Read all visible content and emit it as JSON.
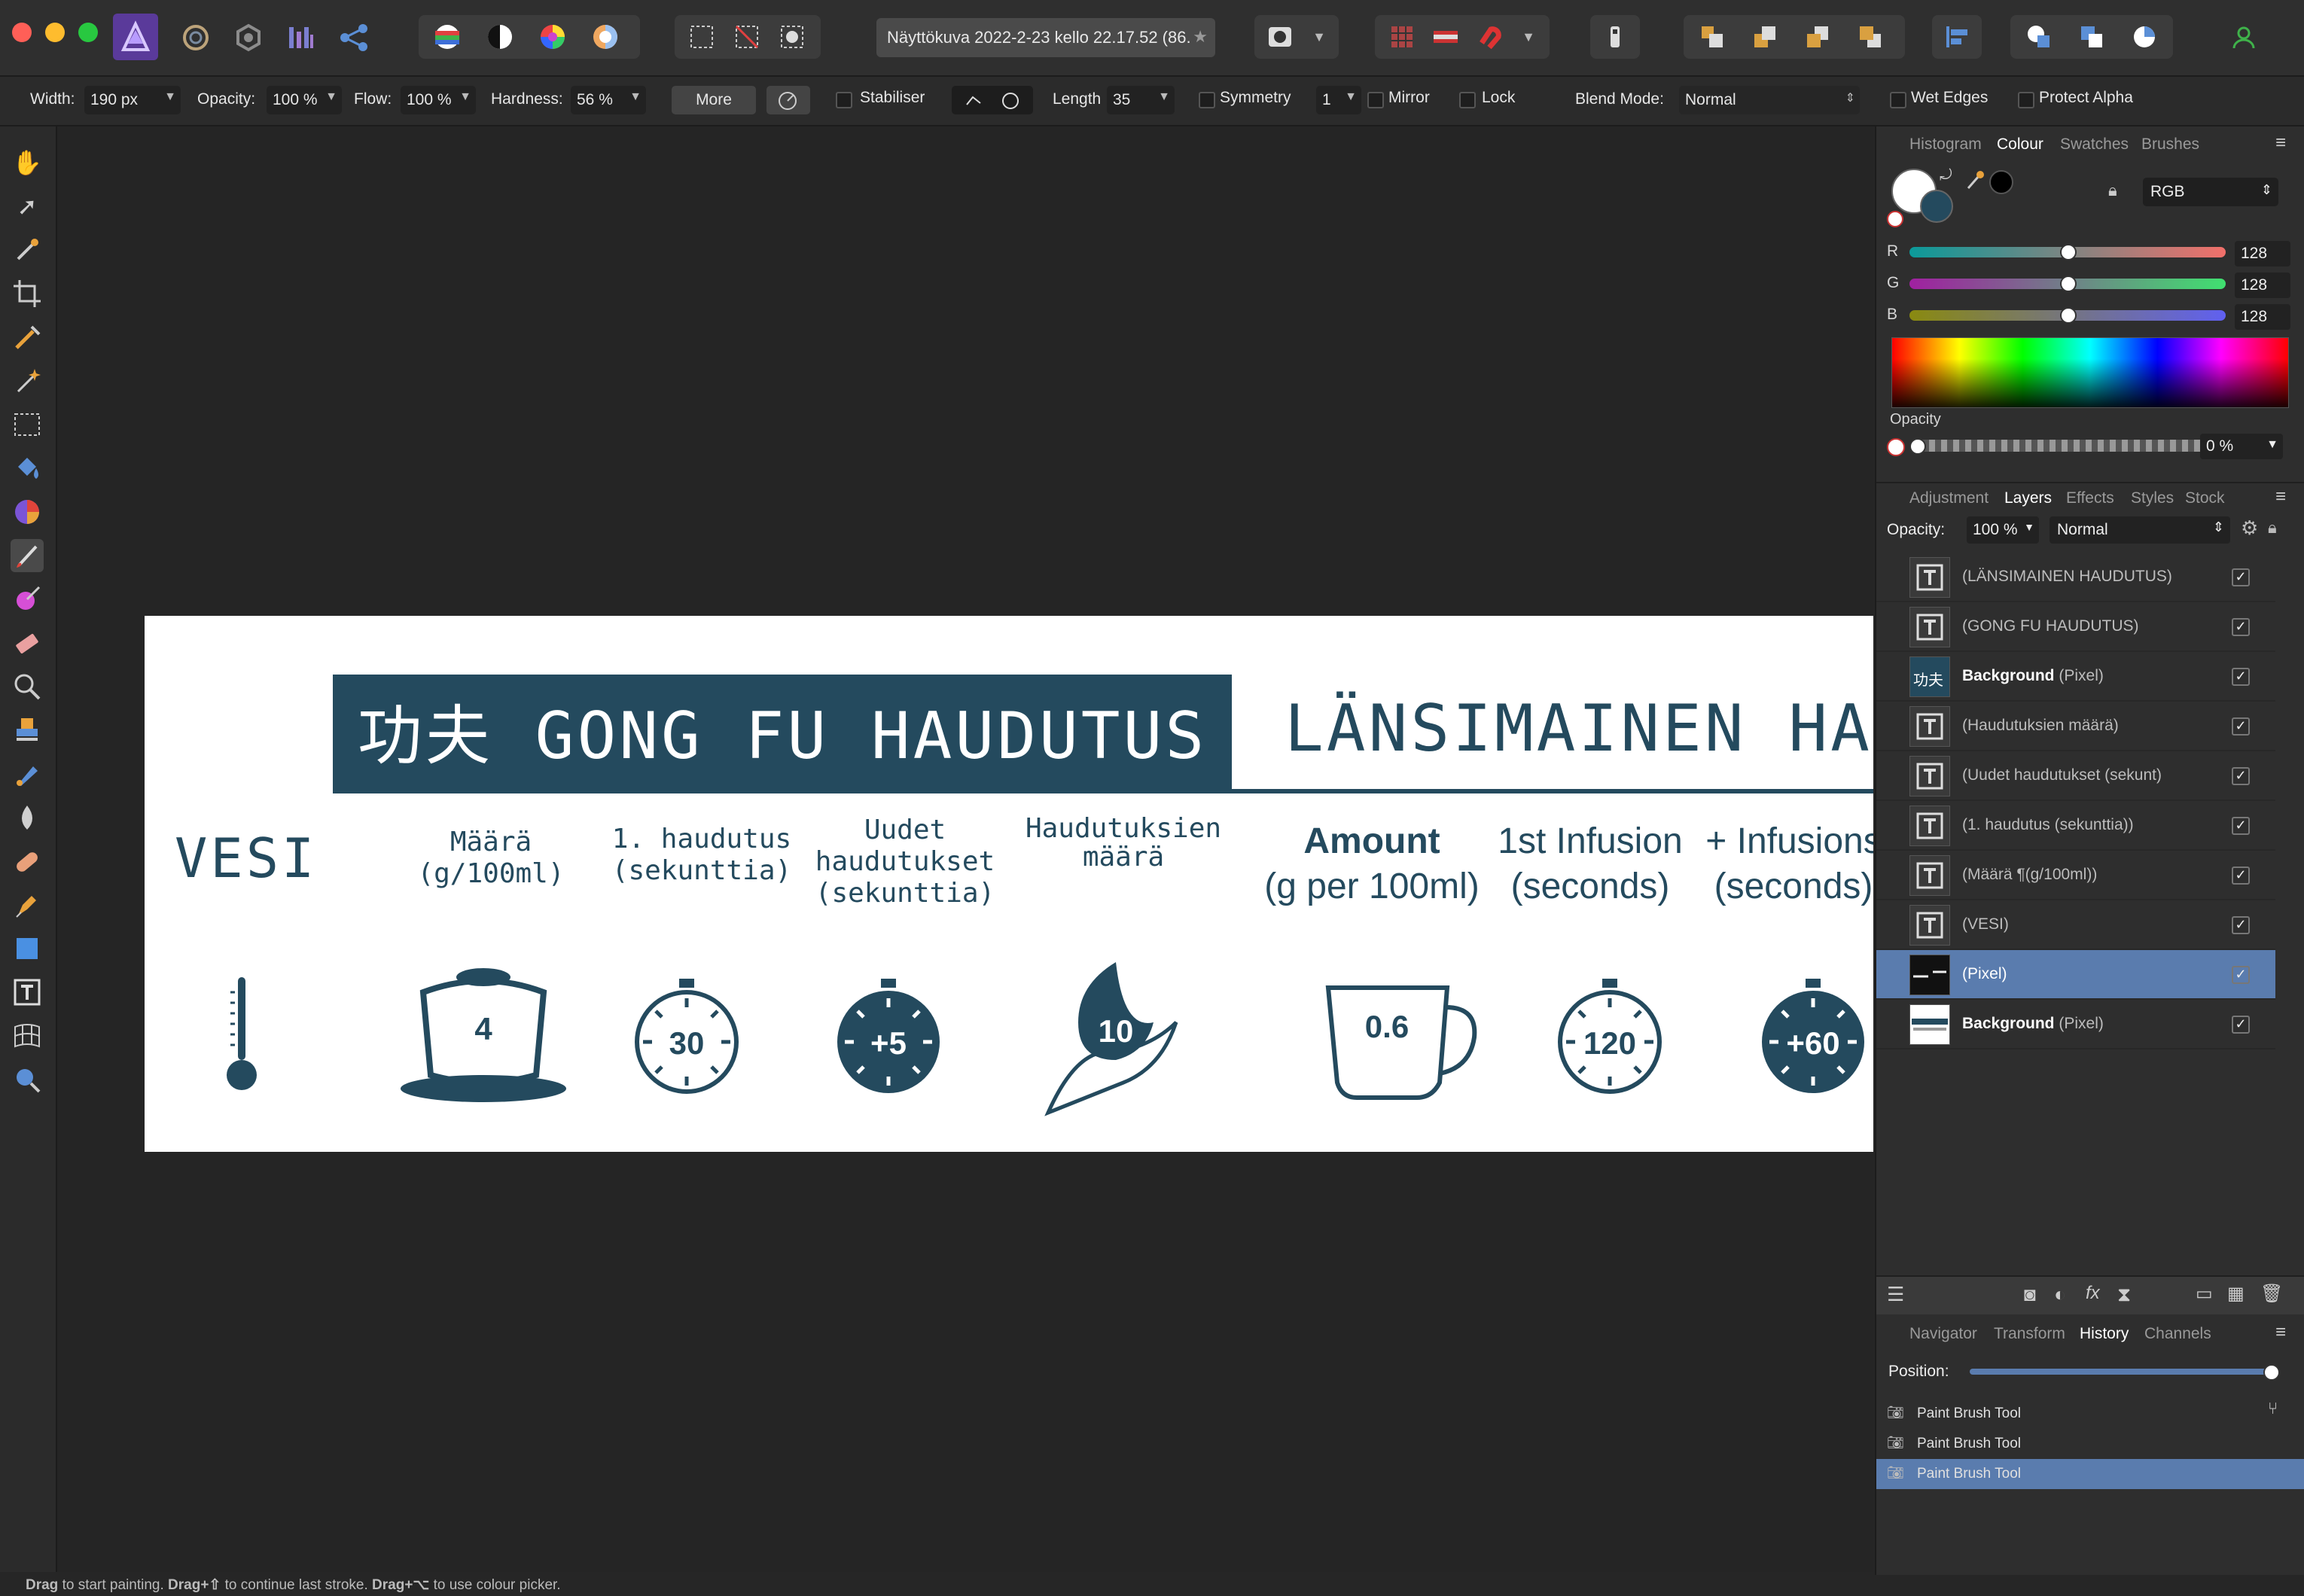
{
  "window": {
    "document_tab": "Näyttökuva 2022-2-23 kello 22.17.52 (86."
  },
  "context_toolbar": {
    "width_label": "Width:",
    "width_value": "190 px",
    "opacity_label": "Opacity:",
    "opacity_value": "100 %",
    "flow_label": "Flow:",
    "flow_value": "100 %",
    "hardness_label": "Hardness:",
    "hardness_value": "56 %",
    "more_label": "More",
    "stabiliser_label": "Stabiliser",
    "length_label": "Length",
    "length_value": "35",
    "symmetry_label": "Symmetry",
    "symmetry_value": "1",
    "mirror_label": "Mirror",
    "lock_label": "Lock",
    "blend_mode_label": "Blend Mode:",
    "blend_mode_value": "Normal",
    "wet_edges_label": "Wet Edges",
    "protect_alpha_label": "Protect Alpha"
  },
  "artwork": {
    "gongfu_title": "功夫 GONG FU HAUDUTUS",
    "western_title": "LÄNSIMAINEN HAUDU",
    "vesi": "VESI",
    "fi_amount_1": "Määrä",
    "fi_amount_2": "(g/100ml)",
    "fi_first_1": "1. haudutus",
    "fi_first_2": "(sekunttia)",
    "fi_new_1": "Uudet",
    "fi_new_2": "haudutukset",
    "fi_new_3": "(sekunttia)",
    "fi_count_1": "Haudutuksien",
    "fi_count_2": "määrä",
    "en_amount_1": "Amount",
    "en_amount_2": "(g per 100ml)",
    "en_first_1": "1st Infusion",
    "en_first_2": "(seconds)",
    "en_plus_1": "+ Infusions",
    "en_plus_2": "(seconds)",
    "en_cut": "A",
    "gaiwan_value": "4",
    "timer_first_value": "30",
    "timer_plus_value": "+5",
    "leaf_value": "10",
    "cup_value": "0.6",
    "timer_western_value": "120",
    "timer_western_plus_value": "+60"
  },
  "colour_panel": {
    "tabs": [
      "Histogram",
      "Colour",
      "Swatches",
      "Brushes"
    ],
    "active_tab": "Colour",
    "model": "RGB",
    "r_label": "R",
    "r_value": "128",
    "g_label": "G",
    "g_value": "128",
    "b_label": "B",
    "b_value": "128",
    "opacity_label": "Opacity",
    "opacity_value": "0 %"
  },
  "layers_panel": {
    "tabs": [
      "Adjustment",
      "Layers",
      "Effects",
      "Styles",
      "Stock"
    ],
    "active_tab": "Layers",
    "opacity_label": "Opacity:",
    "opacity_value": "100 %",
    "blend_value": "Normal",
    "layers": [
      {
        "name": "(LÄNSIMAINEN HAUDUTUS)",
        "bold": "",
        "type": "text"
      },
      {
        "name": "(GONG FU HAUDUTUS)",
        "bold": "",
        "type": "text"
      },
      {
        "name": "(Pixel)",
        "bold": "Background",
        "type": "image",
        "thumb_text": "功夫"
      },
      {
        "name": "(Haudutuksien määrä)",
        "bold": "",
        "type": "text"
      },
      {
        "name": "(Uudet haudutukset (sekunt)",
        "bold": "",
        "type": "text"
      },
      {
        "name": "(1. haudutus (sekunttia))",
        "bold": "",
        "type": "text"
      },
      {
        "name": "(Määrä ¶(g/100ml))",
        "bold": "",
        "type": "text"
      },
      {
        "name": "(VESI)",
        "bold": "",
        "type": "text"
      },
      {
        "name": "(Pixel)",
        "bold": "",
        "type": "pixel",
        "selected": true
      },
      {
        "name": "(Pixel)",
        "bold": "Background",
        "type": "bg"
      }
    ]
  },
  "history_panel": {
    "tabs": [
      "Navigator",
      "Transform",
      "History",
      "Channels"
    ],
    "active_tab": "History",
    "position_label": "Position:",
    "position": 1.0,
    "items": [
      "Paint Brush Tool",
      "Paint Brush Tool",
      "Paint Brush Tool"
    ]
  },
  "status": {
    "k1": "Drag",
    "t1": " to start painting. ",
    "k2": "Drag+⇧",
    "t2": " to continue last stroke. ",
    "k3": "Drag+⌥",
    "t3": " to use colour picker."
  },
  "colors": {
    "navy": "#244a5e",
    "selection": "#5a7cae"
  }
}
